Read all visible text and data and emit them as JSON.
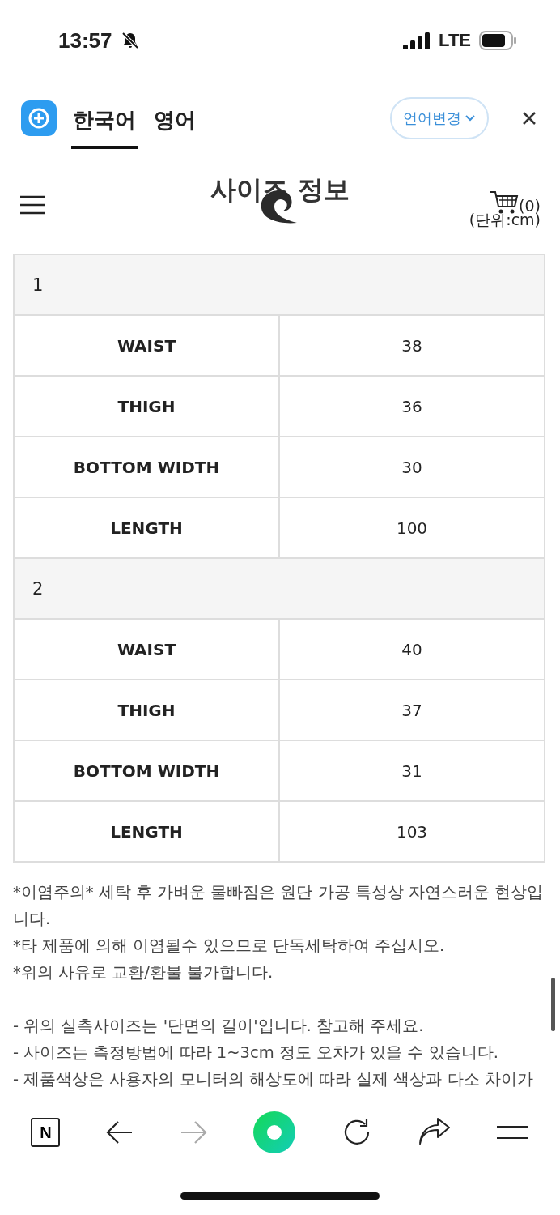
{
  "status_bar": {
    "time": "13:57",
    "network": "LTE"
  },
  "translate_bar": {
    "tabs": [
      {
        "label": "한국어",
        "selected": true
      },
      {
        "label": "영어",
        "selected": false
      }
    ],
    "change_button": "언어변경"
  },
  "header": {
    "title": "사이즈 정보",
    "cart_count": "(0)",
    "unit": "(단위:cm)"
  },
  "size_table": [
    {
      "size": "1",
      "rows": [
        {
          "label": "WAIST",
          "value": "38"
        },
        {
          "label": "THIGH",
          "value": "36"
        },
        {
          "label": "BOTTOM WIDTH",
          "value": "30"
        },
        {
          "label": "LENGTH",
          "value": "100"
        }
      ]
    },
    {
      "size": "2",
      "rows": [
        {
          "label": "WAIST",
          "value": "40"
        },
        {
          "label": "THIGH",
          "value": "37"
        },
        {
          "label": "BOTTOM WIDTH",
          "value": "31"
        },
        {
          "label": "LENGTH",
          "value": "103"
        }
      ]
    }
  ],
  "notes": [
    "*이염주의* 세탁 후 가벼운 물빠짐은 원단 가공 특성상 자연스러운 현상입니다.",
    "*타 제품에 의해 이염될수 있으므로 단독세탁하여 주십시오.",
    "*위의 사유로 교환/환불 불가합니다."
  ],
  "details": [
    "- 위의 실측사이즈는 '단면의 길이'입니다. 참고해 주세요.",
    "- 사이즈는 측정방법에 따라 1~3cm 정도 오차가 있을 수 있습니다.",
    "- 제품색상은 사용자의 모니터의 해상도에 따라 실제 색상과 다소 차이가"
  ],
  "browser_bar": {
    "home_label": "N",
    "forward_disabled": true
  }
}
